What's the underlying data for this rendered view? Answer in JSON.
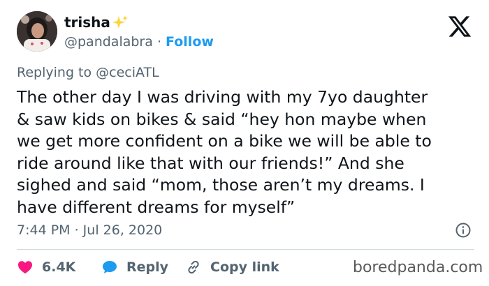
{
  "tweet": {
    "author": {
      "display_name": "trisha",
      "handle": "@pandalabra",
      "separator": "·",
      "follow_label": "Follow"
    },
    "replying_prefix": "Replying to ",
    "replying_to": "@ceciATL",
    "text": "The other day I was driving with my 7yo daughter\n& saw kids on bikes & said “hey hon maybe when\nwe get more confident on a bike we will be able to\nride around like that with our friends!” And she\nsighed and said “mom, those aren’t my dreams. I\nhave different dreams for myself”",
    "timestamp": "7:44 PM · Jul 26, 2020",
    "actions": {
      "like_count": "6.4K",
      "reply_label": "Reply",
      "copy_link_label": "Copy link"
    }
  },
  "watermark": "boredpanda.com",
  "colors": {
    "accent": "#1d9bf0",
    "like": "#f91880",
    "muted": "#536471",
    "text": "#0f1419",
    "divider": "#cfd9de",
    "sparkle": "#ffd43b"
  },
  "icons": {
    "logo": "x-logo-icon",
    "sparkle": "sparkles-icon",
    "like": "heart-icon",
    "reply": "speech-bubble-icon",
    "copy": "link-icon",
    "info": "info-icon"
  }
}
